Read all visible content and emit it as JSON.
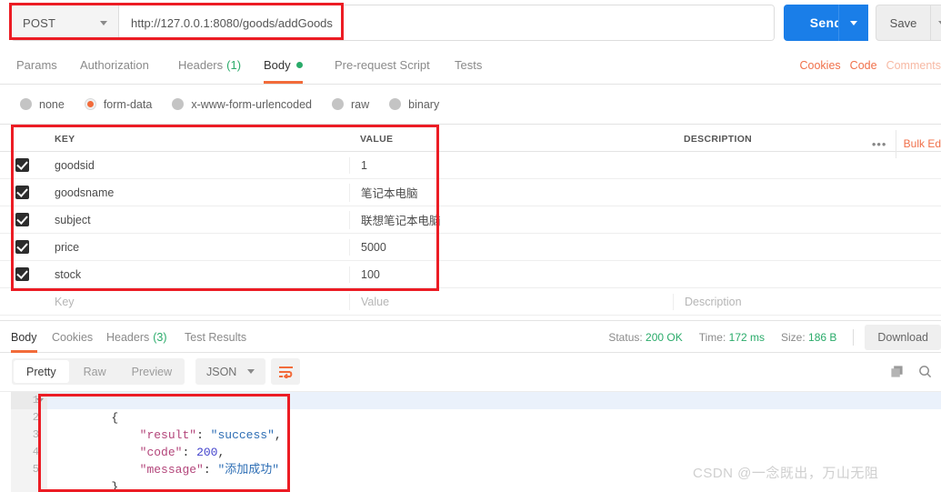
{
  "request": {
    "method": "POST",
    "url": "http://127.0.0.1:8080/goods/addGoods",
    "send_label": "Send",
    "save_label": "Save"
  },
  "request_tabs": [
    {
      "label": "Params",
      "active": false
    },
    {
      "label": "Authorization",
      "active": false
    },
    {
      "label": "Headers",
      "count": "(1)",
      "active": false
    },
    {
      "label": "Body",
      "active": true
    },
    {
      "label": "Pre-request Script",
      "active": false
    },
    {
      "label": "Tests",
      "active": false
    }
  ],
  "request_tab_links": [
    {
      "label": "Cookies"
    },
    {
      "label": "Code"
    },
    {
      "label": "Comments"
    }
  ],
  "body_modes": [
    {
      "label": "none",
      "selected": false
    },
    {
      "label": "form-data",
      "selected": true
    },
    {
      "label": "x-www-form-urlencoded",
      "selected": false
    },
    {
      "label": "raw",
      "selected": false
    },
    {
      "label": "binary",
      "selected": false
    }
  ],
  "kv_table": {
    "headers": {
      "key": "KEY",
      "value": "VALUE",
      "description": "DESCRIPTION"
    },
    "bulk_edit_label": "Bulk Ed",
    "more_icon": "•••",
    "rows": [
      {
        "checked": true,
        "key": "goodsid",
        "value": "1",
        "description": ""
      },
      {
        "checked": true,
        "key": "goodsname",
        "value": "笔记本电脑",
        "description": ""
      },
      {
        "checked": true,
        "key": "subject",
        "value": "联想笔记本电脑",
        "description": ""
      },
      {
        "checked": true,
        "key": "price",
        "value": "5000",
        "description": ""
      },
      {
        "checked": true,
        "key": "stock",
        "value": "100",
        "description": ""
      }
    ],
    "placeholder_row": {
      "key": "Key",
      "value": "Value",
      "description": "Description"
    }
  },
  "response_tabs": [
    {
      "label": "Body",
      "active": true
    },
    {
      "label": "Cookies",
      "active": false
    },
    {
      "label": "Headers",
      "count": "(3)",
      "active": false
    },
    {
      "label": "Test Results",
      "active": false
    }
  ],
  "response_status": {
    "status_label": "Status:",
    "status_value": "200 OK",
    "time_label": "Time:",
    "time_value": "172 ms",
    "size_label": "Size:",
    "size_value": "186 B",
    "download_label": "Download"
  },
  "viewer_toolbar": {
    "modes": [
      {
        "label": "Pretty",
        "selected": true
      },
      {
        "label": "Raw",
        "selected": false
      },
      {
        "label": "Preview",
        "selected": false
      }
    ],
    "format": "JSON",
    "copy_icon": "copy-icon",
    "search_icon": "search-icon",
    "wrap_icon": "wrap-lines-icon"
  },
  "response_body": {
    "line_numbers": [
      "1",
      "2",
      "3",
      "4",
      "5"
    ],
    "lines": [
      {
        "n": "1",
        "open": "{"
      },
      {
        "n": "2",
        "key": "\"result\"",
        "sep": ": ",
        "val": "\"success\"",
        "type": "str",
        "tail": ","
      },
      {
        "n": "3",
        "key": "\"code\"",
        "sep": ": ",
        "val": "200",
        "type": "num",
        "tail": ","
      },
      {
        "n": "4",
        "key": "\"message\"",
        "sep": ": ",
        "val": "\"添加成功\"",
        "type": "str",
        "tail": ""
      },
      {
        "n": "5",
        "close": "}"
      }
    ]
  },
  "watermark": {
    "text": "CSDN @一念既出，万山无阻"
  },
  "colors": {
    "accent_orange": "#f26b3a",
    "send_blue": "#1a7ee8",
    "success_green": "#2aab6a",
    "annotation_red": "#ec1c24"
  }
}
